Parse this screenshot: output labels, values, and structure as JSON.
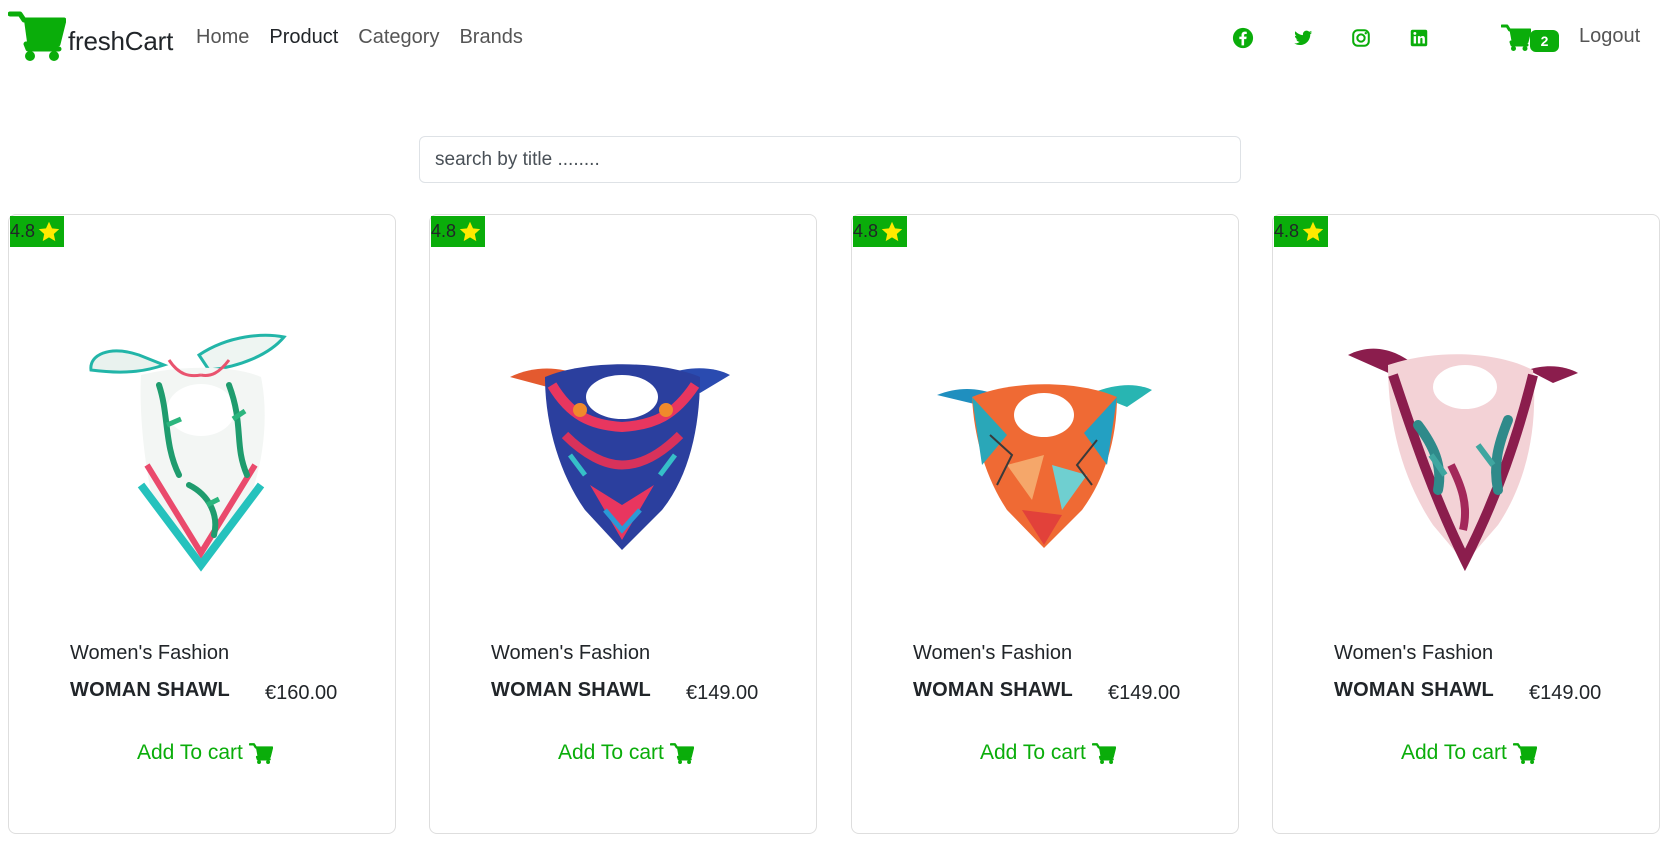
{
  "navbar": {
    "brand": "freshCart",
    "links": [
      {
        "label": "Home",
        "active": false
      },
      {
        "label": "Product",
        "active": true
      },
      {
        "label": "Category",
        "active": false
      },
      {
        "label": "Brands",
        "active": false
      }
    ],
    "social_icons": [
      "facebook-icon",
      "twitter-icon",
      "instagram-icon",
      "linkedin-icon"
    ],
    "cart_count": "2",
    "logout": "Logout"
  },
  "search": {
    "placeholder": "search by title ........"
  },
  "colors": {
    "accent": "#0aad0a",
    "star": "#ffea00"
  },
  "products": [
    {
      "rating": "4.8",
      "category": "Women's Fashion",
      "title": "WOMAN SHAWL",
      "price": "€160.00",
      "add_label": "Add To cart",
      "image": "white-teal-floral-scarf"
    },
    {
      "rating": "4.8",
      "category": "Women's Fashion",
      "title": "WOMAN SHAWL",
      "price": "€149.00",
      "add_label": "Add To cart",
      "image": "navy-pink-patterned-scarf"
    },
    {
      "rating": "4.8",
      "category": "Women's Fashion",
      "title": "WOMAN SHAWL",
      "price": "€149.00",
      "add_label": "Add To cart",
      "image": "orange-teal-geometric-scarf"
    },
    {
      "rating": "4.8",
      "category": "Women's Fashion",
      "title": "WOMAN SHAWL",
      "price": "€149.00",
      "add_label": "Add To cart",
      "image": "burgundy-pink-leaf-scarf"
    }
  ]
}
